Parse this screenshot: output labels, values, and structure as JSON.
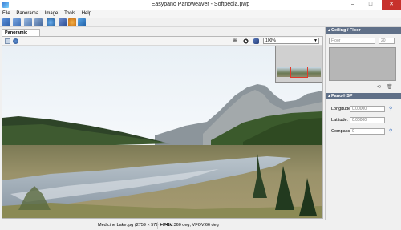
{
  "window": {
    "title": "Easypano Panoweaver - Softpedia.pwp",
    "minimize": "–",
    "maximize": "□",
    "close": "✕"
  },
  "menu": {
    "items": [
      "File",
      "Panorama",
      "Image",
      "Tools",
      "Help"
    ]
  },
  "toolbar": {
    "icons": [
      "new-icon",
      "open-icon",
      "stitch-icon",
      "publish-icon",
      "preview-icon",
      "save-icon",
      "globe-icon",
      "export-icon"
    ]
  },
  "document": {
    "tab_label": "Panoramic Image"
  },
  "viewer": {
    "zoom": "100%"
  },
  "right_panel": {
    "ceiling_floor": {
      "title": "Ceiling / Floor",
      "mode": "Floor",
      "value": "20"
    },
    "pano_hotspot": {
      "title": "Pano-HSP",
      "longitude_label": "Longitude:",
      "longitude_value": "0.00000",
      "latitude_label": "Latitude:",
      "latitude_value": "0.00000",
      "compass_label": "Compass:",
      "compass_value": "0"
    }
  },
  "status": {
    "file_info": "Medicine Lake.jpg (2759 × 579 × 24b",
    "fov_info": "HFOV:360 deg, VFOV:66 deg"
  },
  "colors": {
    "panel_header": "#607088",
    "selection_box": "#e23a2a",
    "close_button": "#c7312c"
  }
}
